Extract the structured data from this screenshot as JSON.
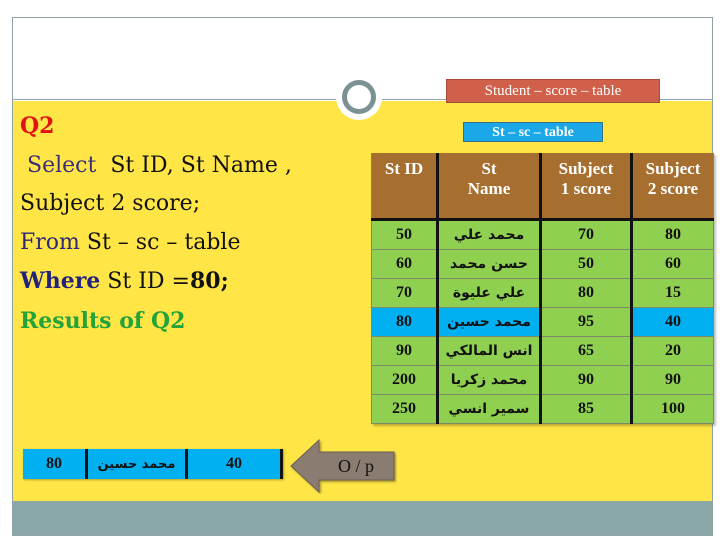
{
  "slide": {
    "title_tag": "Student – score – table",
    "colors": {
      "background_yellow": "#ffe545",
      "title_tag_bg": "#d0604a",
      "table_header_bg": "#a66f30",
      "table_row_bg": "#90d050",
      "highlight_bg": "#00b0f0",
      "footer_band": "#8aa8a8"
    }
  },
  "query": {
    "label": "Q2",
    "select_keyword": "Select",
    "select_fields": "St ID, St Name ,",
    "select_fields_cont": "Subject 2 score;",
    "from_keyword": "From",
    "from_table": "St – sc – table",
    "where_keyword": "Where",
    "where_condition": "St ID =",
    "where_value": "80;",
    "results_label": "Results of Q2"
  },
  "table": {
    "caption": "St – sc – table",
    "columns": [
      "St ID",
      "St Name",
      "Subject 1 score",
      "Subject 2 score"
    ],
    "rows": [
      {
        "id": "50",
        "name": "محمد علي",
        "s1": "70",
        "s2": "80",
        "highlighted": false
      },
      {
        "id": "60",
        "name": "حسن محمد",
        "s1": "50",
        "s2": "60",
        "highlighted": false
      },
      {
        "id": "70",
        "name": "علي عليوة",
        "s1": "80",
        "s2": "15",
        "highlighted": false
      },
      {
        "id": "80",
        "name": "محمد حسين",
        "s1": "95",
        "s2": "40",
        "highlighted": true
      },
      {
        "id": "90",
        "name": "انس المالكي",
        "s1": "65",
        "s2": "20",
        "highlighted": false
      },
      {
        "id": "200",
        "name": "محمد زكريا",
        "s1": "90",
        "s2": "90",
        "highlighted": false
      },
      {
        "id": "250",
        "name": "سمير انسي",
        "s1": "85",
        "s2": "100",
        "highlighted": false
      }
    ]
  },
  "output": {
    "arrow_label": "O / p",
    "arrow_icon": "left-arrow-icon",
    "id": "80",
    "name": "محمد حسين",
    "s2": "40"
  }
}
